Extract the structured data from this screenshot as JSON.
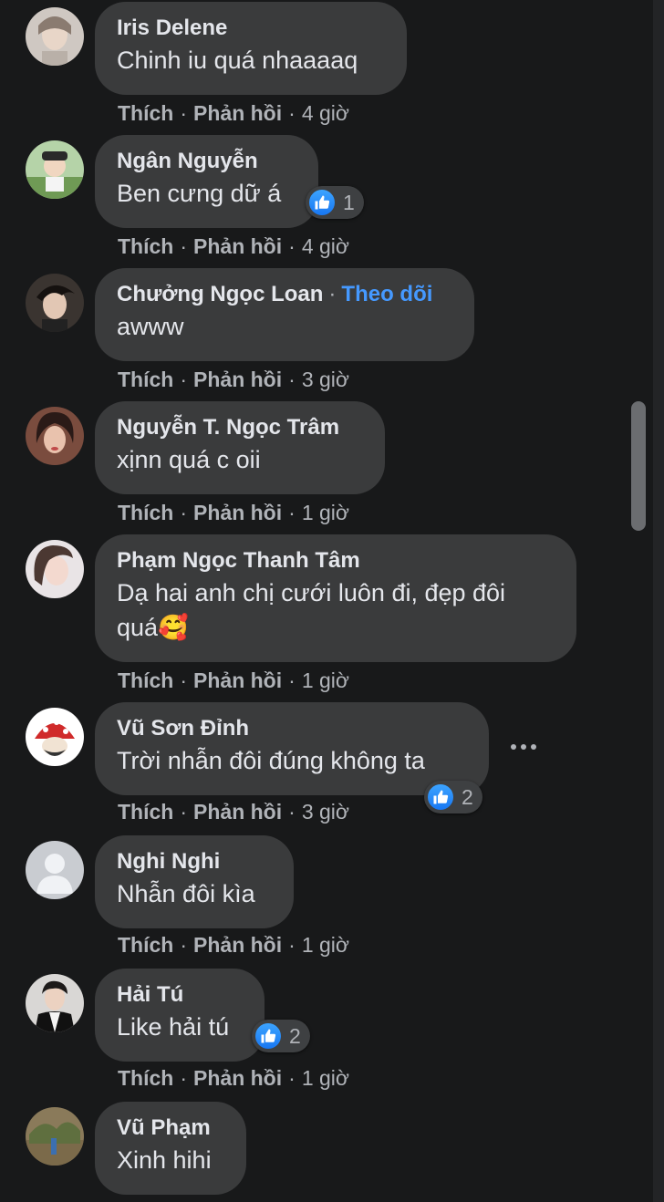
{
  "colors": {
    "background": "#18191a",
    "bubble": "#3a3b3c",
    "link": "#4599ff",
    "like": "#1877f2"
  },
  "icons": {
    "reaction": "thumbs-up-icon",
    "menu": "more-horizontal-icon"
  },
  "action_labels": {
    "like": "Thích",
    "reply": "Phản hồi",
    "separator": "·"
  },
  "comments": [
    {
      "author": "Iris Delene",
      "text": [
        "Chinh iu quá nhaaaaq"
      ],
      "time": "4 giờ",
      "reactions": null
    },
    {
      "author": "Ngân Nguyễn",
      "text": [
        "Ben cưng dữ á"
      ],
      "time": "4 giờ",
      "reactions": "1"
    },
    {
      "author": "Chưởng Ngọc Loan",
      "follow": "Theo dõi",
      "text": [
        "awww"
      ],
      "time": "3 giờ",
      "reactions": null
    },
    {
      "author": "Nguyễn T. Ngọc Trâm",
      "text": [
        "xịnn quá c oii"
      ],
      "time": "1 giờ",
      "reactions": null
    },
    {
      "author": "Phạm Ngọc Thanh Tâm",
      "text": [
        "Dạ hai anh chị cưới luôn đi, đẹp đôi",
        "quá🥰"
      ],
      "time": "1 giờ",
      "reactions": null
    },
    {
      "author": "Vũ Sơn Đỉnh",
      "text": [
        "Trời nhẫn đôi đúng không ta"
      ],
      "time": "3 giờ",
      "reactions": "2"
    },
    {
      "author": "Nghi Nghi",
      "text": [
        "Nhẫn đôi kìa"
      ],
      "time": "1 giờ",
      "reactions": null
    },
    {
      "author": "Hải Tú",
      "text": [
        "Like hải tú"
      ],
      "time": "1 giờ",
      "reactions": "2"
    },
    {
      "author": "Vũ Phạm",
      "text": [
        "Xinh hihi"
      ],
      "time": "",
      "reactions": null
    }
  ]
}
